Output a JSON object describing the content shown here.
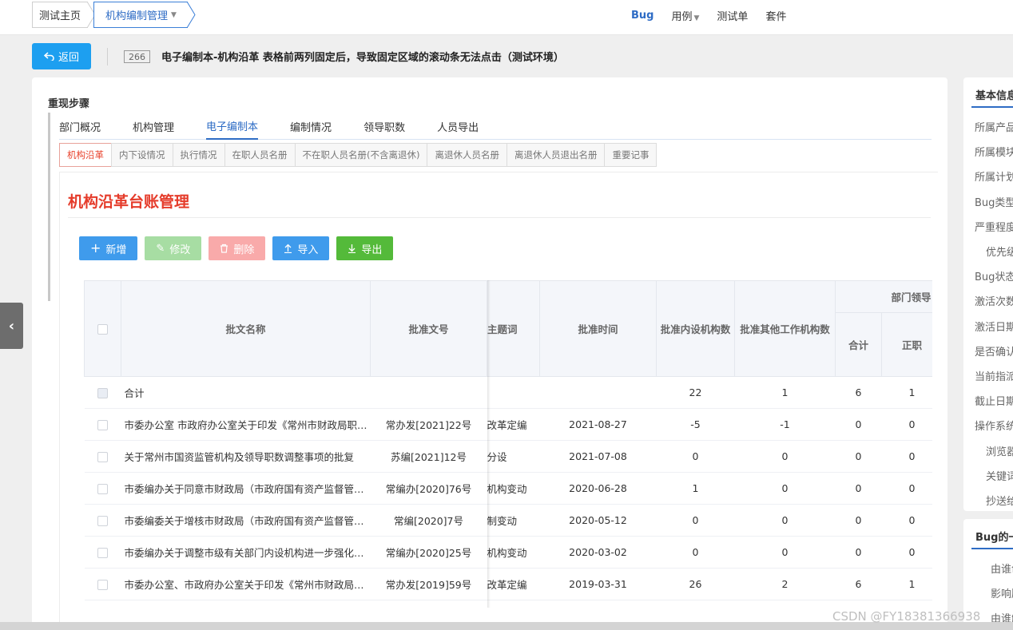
{
  "topnav": {
    "breadcrumb_home": "测试主页",
    "breadcrumb_current": "机构编制管理",
    "links": [
      "Bug",
      "用例",
      "测试单",
      "套件"
    ]
  },
  "header": {
    "back_label": "返回",
    "bug_id": "266",
    "bug_title": "电子编制本-机构沿革 表格前两列固定后，导致固定区域的滚动条无法点击（测试环境）"
  },
  "main": {
    "section_title": "重现步骤",
    "tabs": [
      "部门概况",
      "机构管理",
      "电子编制本",
      "编制情况",
      "领导职数",
      "人员导出"
    ],
    "active_tab": 2,
    "subtabs": [
      "机构沿革",
      "内下设情况",
      "执行情况",
      "在职人员名册",
      "不在职人员名册(不含离退休)",
      "离退休人员名册",
      "离退休人员退出名册",
      "重要记事"
    ],
    "page_heading": "机构沿革台账管理",
    "toolbar": {
      "add": "新增",
      "edit": "修改",
      "delete": "删除",
      "import": "导入",
      "export": "导出"
    },
    "table": {
      "headers": {
        "name": "批文名称",
        "doc_no": "批准文号",
        "topic": "主题词",
        "date": "批准时间",
        "inner_count": "批准内设机构数",
        "other_count": "批准其他工作机构数",
        "leader_group": "部门领导",
        "total": "合计",
        "chief": "正职"
      },
      "rows": [
        {
          "name": "合计",
          "doc_no": "",
          "topic": "",
          "date": "",
          "inner": "22",
          "other": "1",
          "total": "6",
          "chief": "1"
        },
        {
          "name": "市委办公室 市政府办公室关于印发《常州市财政局职能配置、内设机构和人员编制规定》的通知",
          "doc_no": "常办发[2021]22号",
          "topic": "改革定编",
          "date": "2021-08-27",
          "inner": "-5",
          "other": "-1",
          "total": "0",
          "chief": "0"
        },
        {
          "name": "关于常州市国资监管机构及领导职数调整事项的批复",
          "doc_no": "苏编[2021]12号",
          "topic": "分设",
          "date": "2021-07-08",
          "inner": "0",
          "other": "0",
          "total": "0",
          "chief": "0"
        },
        {
          "name": "市委编办关于同意市财政局（市政府国有资产监督管理委员会）机构变动的批复",
          "doc_no": "常编办[2020]76号",
          "topic": "机构变动",
          "date": "2020-06-28",
          "inner": "1",
          "other": "0",
          "total": "0",
          "chief": "0"
        },
        {
          "name": "市委编委关于增核市财政局（市政府国有资产监督管理委员会）编制的通知",
          "doc_no": "常编[2020]7号",
          "topic": "制变动",
          "date": "2020-05-12",
          "inner": "0",
          "other": "0",
          "total": "0",
          "chief": "0"
        },
        {
          "name": "市委编办关于调整市级有关部门内设机构进一步强化职能的通知",
          "doc_no": "常编办[2020]25号",
          "topic": "机构变动",
          "date": "2020-03-02",
          "inner": "0",
          "other": "0",
          "total": "0",
          "chief": "0"
        },
        {
          "name": "市委办公室、市政府办公室关于印发《常州市财政局职能配置、内设机构和人员编制规定》的通知",
          "doc_no": "常办发[2019]59号",
          "topic": "改革定编",
          "date": "2019-03-31",
          "inner": "26",
          "other": "2",
          "total": "6",
          "chief": "1"
        }
      ]
    }
  },
  "right_panel": {
    "title": "基本信息",
    "items": [
      "所属产品",
      "所属模块",
      "所属计划",
      "Bug类型",
      "严重程度",
      "优先级",
      "Bug状态",
      "激活次数",
      "激活日期",
      "是否确认",
      "当前指派",
      "截止日期",
      "操作系统",
      "浏览器",
      "关键词",
      "抄送给"
    ]
  },
  "right_panel2": {
    "title": "Bug的一生",
    "items": [
      "由谁创建",
      "影响版本",
      "由谁解决"
    ]
  },
  "watermark": "CSDN @FY18381366938",
  "colors": {
    "accent": "#2e6cc5",
    "heading_red": "#e53b2a",
    "highlight_red": "#e60012"
  }
}
